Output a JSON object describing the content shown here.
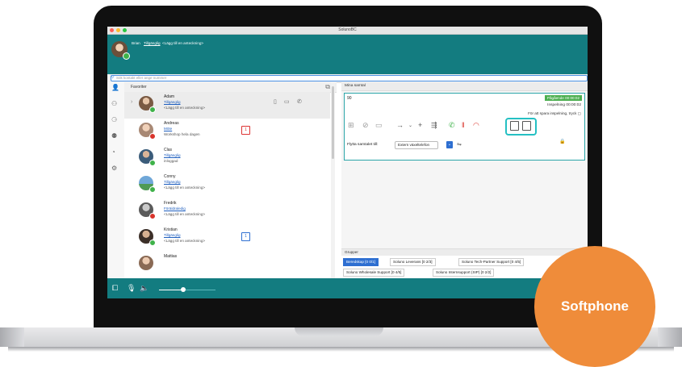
{
  "window": {
    "title": "SolunoBC"
  },
  "header": {
    "user_name": "Brian",
    "user_status": "Tillgänglig",
    "user_note": "<Lägg till en anteckning>"
  },
  "search": {
    "placeholder": "Sök kontakt eller ange nummer"
  },
  "favorites": {
    "title": "Favoriter",
    "contacts": [
      {
        "name": "Adam",
        "status": "Tillgänglig",
        "note": "<Lägg till en anteckning>",
        "presence": "available"
      },
      {
        "name": "Andreas",
        "status": "Möte",
        "note": "Workshop hela dagen",
        "presence": "busy",
        "calendar": "1"
      },
      {
        "name": "Clas",
        "status": "Tillgänglig",
        "note": "inloggad",
        "presence": "available"
      },
      {
        "name": "Conny",
        "status": "Tillgänglig",
        "note": "<Lägg till en anteckning>",
        "presence": "available"
      },
      {
        "name": "Fredrik",
        "status": "Föräldraledig",
        "note": "<Lägg till en anteckning>",
        "presence": "busy"
      },
      {
        "name": "Kristian",
        "status": "Tillgänglig",
        "note": "<Lägg till en anteckning>",
        "presence": "available",
        "calendar": "1"
      },
      {
        "name": "Mattias",
        "status": "",
        "note": "",
        "presence": "available"
      }
    ]
  },
  "calls": {
    "title": "Mina samtal",
    "number": "90",
    "badge": "Pågående 00:00:02",
    "recording": "Inspelning 00:00:02",
    "hint": "För att spara inspelning, tryck",
    "move_label": "Flytta samtalet till:",
    "move_option": "Extern växeltelefon"
  },
  "groups": {
    "title": "Grupper",
    "items": [
      "Beredskap [0 0/1]",
      "Soluno Leverans [0 2/3]",
      "Soluno Tech-Partner Support [0 4/5]",
      "Soluno Wholesale Support [0 4/5]",
      "Soluno Internsupport (SIP) [0 2/2]"
    ]
  },
  "badge": {
    "label": "Softphone"
  },
  "colors": {
    "teal": "#137c80",
    "highlight": "#25c0c3",
    "orange": "#ef8c3a",
    "available": "#3fb24a",
    "busy": "#d9342b"
  }
}
